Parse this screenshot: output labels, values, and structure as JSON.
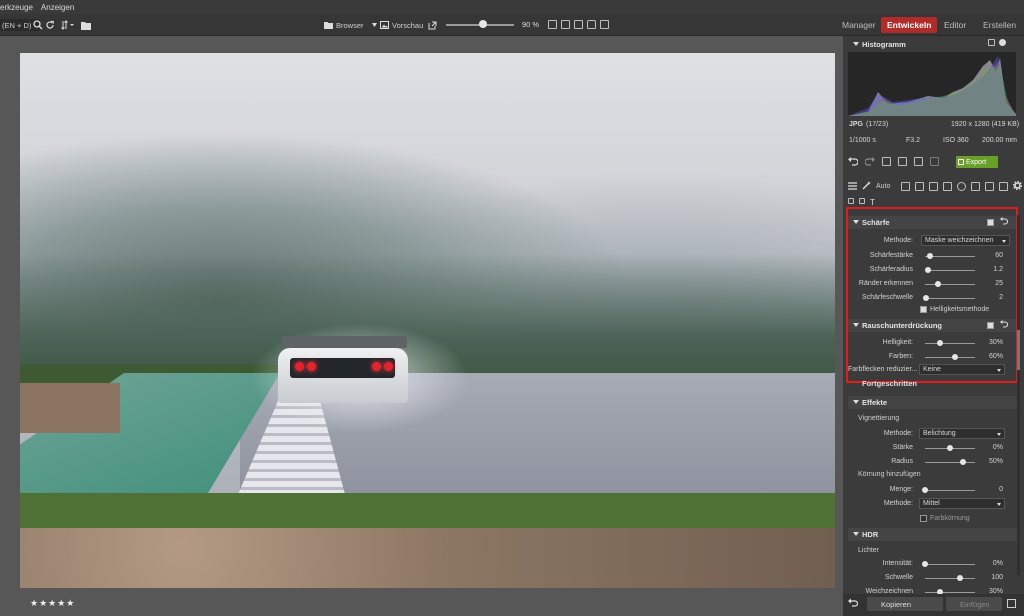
{
  "menu": {
    "items": [
      "erkzeuge",
      "Anzeigen"
    ]
  },
  "toolbar": {
    "lang_field": "(EN + D)",
    "browser": "Browser",
    "preview": "Vorschau",
    "zoom": "90 %",
    "zoom_fraction": 0.55
  },
  "modes": {
    "manager": "Manager",
    "develop": "Entwickeln",
    "editor": "Editor",
    "create": "Erstellen"
  },
  "histogram": {
    "title": "Histogramm",
    "format": "JPG",
    "index": "(17/23)",
    "dimensions": "1920 x 1280 (419 KB)",
    "shutter": "1/1000 s",
    "aperture": "F3.2",
    "iso": "ISO 360",
    "focal": "200.00 mm"
  },
  "actions": {
    "export": "Export",
    "auto": "Auto"
  },
  "sharpen": {
    "title": "Schärfe",
    "method_label": "Methode:",
    "method_value": "Maske weichzeichnen",
    "sliders": [
      {
        "label": "Schärfestärke",
        "value": "60",
        "level": 0.1
      },
      {
        "label": "Schärferadius",
        "value": "1.2",
        "level": 0.05
      },
      {
        "label": "Ränder erkennen",
        "value": "25",
        "level": 0.25
      },
      {
        "label": "Schärfeschwelle",
        "value": "2",
        "level": 0.02
      }
    ],
    "brightness_method": "Helligkeitsmethode"
  },
  "noise": {
    "title": "Rauschunterdrückung",
    "sliders": [
      {
        "label": "Helligkeit:",
        "value": "30%",
        "level": 0.3
      },
      {
        "label": "Farben:",
        "value": "60%",
        "level": 0.6
      }
    ],
    "spots_label": "Farbflecken reduzier...",
    "spots_value": "Keine"
  },
  "advanced": {
    "title": "Fortgeschritten"
  },
  "effects": {
    "title": "Effekte",
    "vignette_title": "Vignettierung",
    "vignette_method_label": "Methode:",
    "vignette_method_value": "Belichtung",
    "vignette_sliders": [
      {
        "label": "Stärke",
        "value": "0%",
        "level": 0.5
      },
      {
        "label": "Radius",
        "value": "50%",
        "level": 0.75
      }
    ],
    "grain_title": "Körnung hinzufügen",
    "grain_amount_label": "Menge:",
    "grain_amount_value": "0",
    "grain_amount_level": 0.0,
    "grain_method_label": "Methode:",
    "grain_method_value": "Mittel",
    "grain_color": "Farbkörnung"
  },
  "hdr": {
    "title": "HDR",
    "lights_title": "Lichter",
    "sliders": [
      {
        "label": "Intensität:",
        "value": "0%",
        "level": 0.0
      },
      {
        "label": "Schwelle",
        "value": "100",
        "level": 0.7
      },
      {
        "label": "Weichzeichnen",
        "value": "30%",
        "level": 0.3
      }
    ]
  },
  "bottom": {
    "copy": "Kopieren",
    "paste": "Einfügen"
  },
  "rating": {
    "stars": "★★★★★"
  },
  "colors": {
    "accent": "#b12b2b",
    "highlight_box": "#e11c1c",
    "export": "#6aa02a"
  }
}
